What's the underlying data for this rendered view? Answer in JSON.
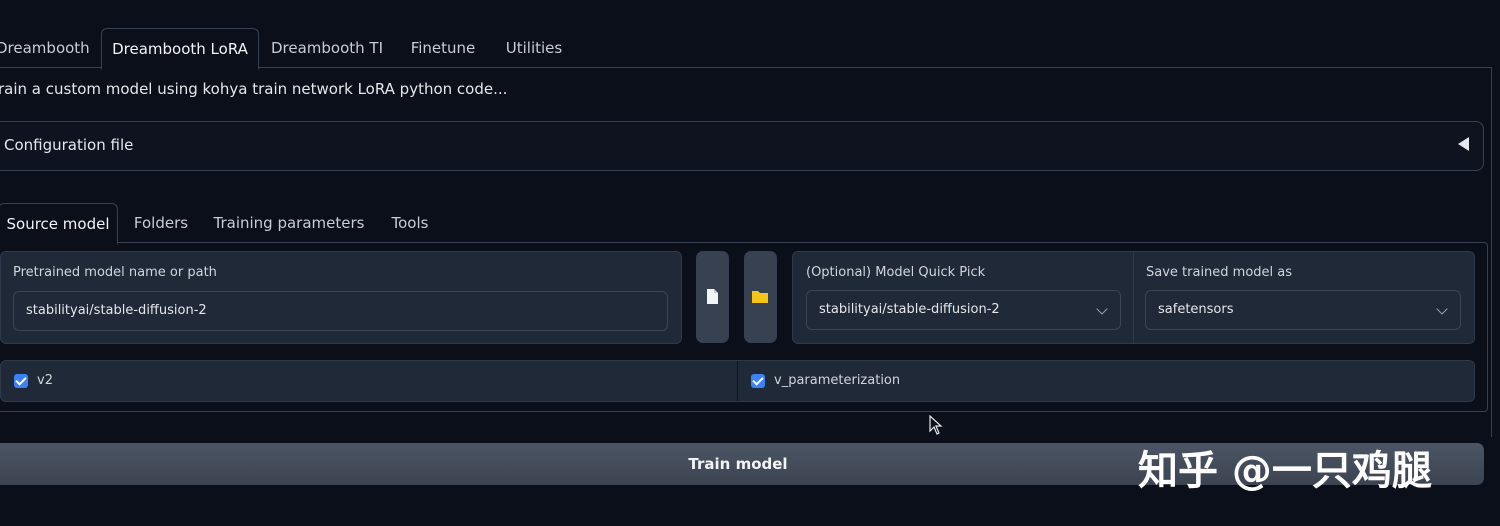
{
  "tabs": [
    "Dreambooth",
    "Dreambooth LoRA",
    "Dreambooth TI",
    "Finetune",
    "Utilities"
  ],
  "description": "rain a custom model using kohya train network LoRA python code...",
  "config_accordion": {
    "label": "Configuration file"
  },
  "inner_tabs": [
    "Source model",
    "Folders",
    "Training parameters",
    "Tools"
  ],
  "source_model": {
    "pretrained_label": "Pretrained model name or path",
    "pretrained_value": "stabilityai/stable-diffusion-2",
    "quick_pick_label": "(Optional) Model Quick Pick",
    "quick_pick_value": "stabilityai/stable-diffusion-2",
    "save_as_label": "Save trained model as",
    "save_as_value": "safetensors",
    "file_icon": "file-icon",
    "folder_icon": "folder-icon"
  },
  "checkboxes": [
    {
      "label": "v2",
      "checked": true
    },
    {
      "label": "v_parameterization",
      "checked": true
    }
  ],
  "train_button": "Train model",
  "watermark": "知乎 @一只鸡腿",
  "colors": {
    "accent": "#3b82f6",
    "background": "#0b0f19",
    "folder": "#f5c518"
  }
}
